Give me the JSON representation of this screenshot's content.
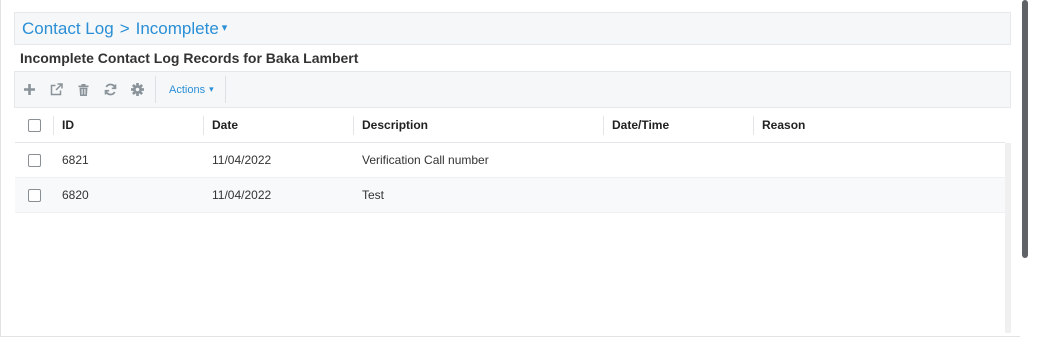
{
  "breadcrumb": {
    "section": "Contact Log",
    "separator": ">",
    "current": "Incomplete",
    "caret": "▾"
  },
  "subtitle": "Incomplete Contact Log Records for Baka Lambert",
  "toolbar": {
    "icons": [
      "plus-icon",
      "external-link-icon",
      "trash-icon",
      "refresh-icon",
      "gear-icon"
    ],
    "actions_label": "Actions",
    "actions_caret": "▾"
  },
  "grid": {
    "columns": {
      "id": "ID",
      "date": "Date",
      "description": "Description",
      "datetime": "Date/Time",
      "reason": "Reason"
    },
    "rows": [
      {
        "id": "6821",
        "date": "11/04/2022",
        "description": "Verification Call number",
        "datetime": "",
        "reason": ""
      },
      {
        "id": "6820",
        "date": "11/04/2022",
        "description": "Test",
        "datetime": "",
        "reason": ""
      }
    ]
  },
  "colors": {
    "accent": "#2b8fd6",
    "toolbar_bg": "#f5f7f9",
    "icon_gray": "#8a9399"
  }
}
